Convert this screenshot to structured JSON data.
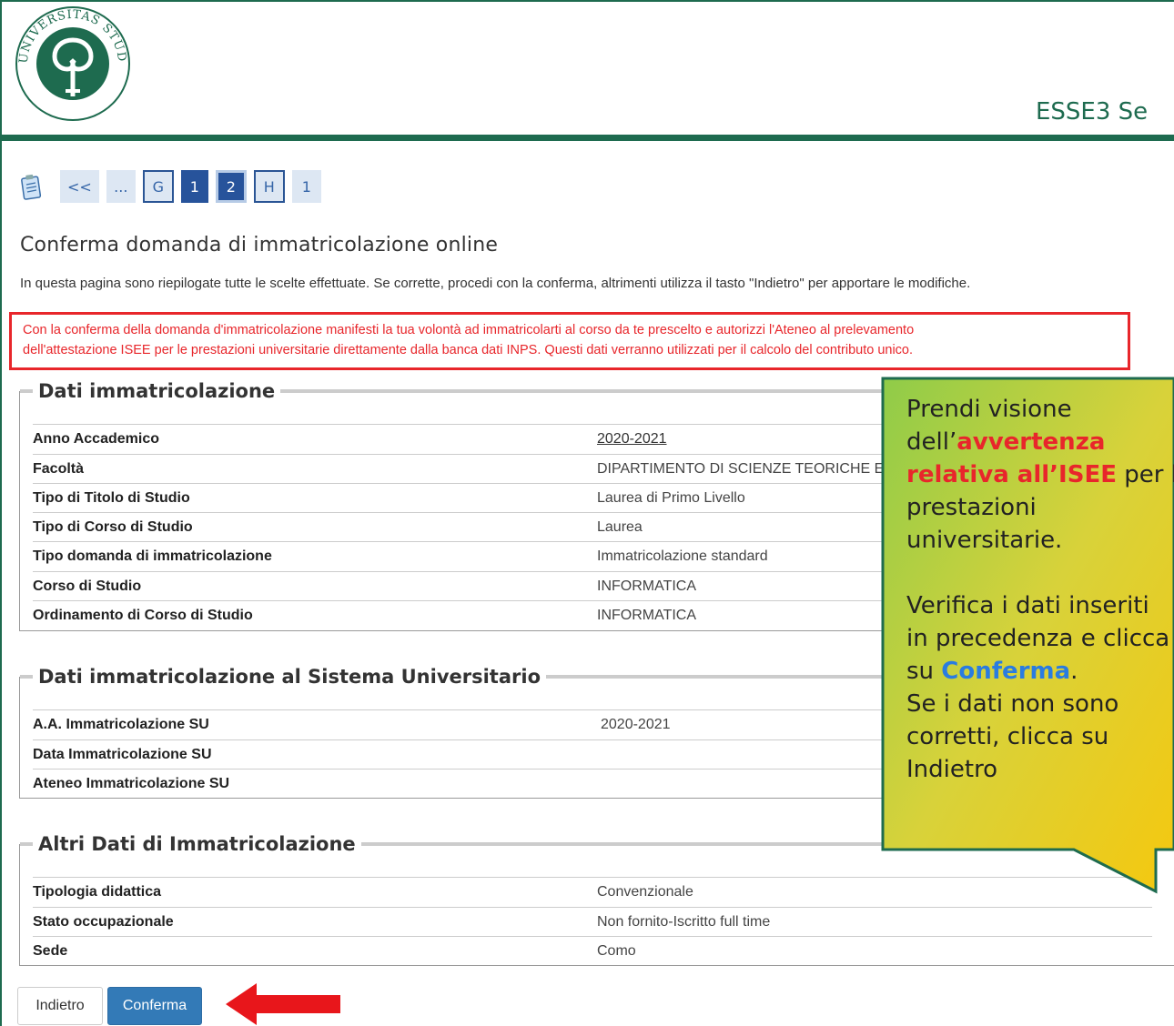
{
  "header": {
    "system_name": "ESSE3 Se",
    "logo_icon": "university-seal-icon",
    "logo_text": "UNIVERSITAS STUDIORUM INSUBRIAE"
  },
  "wizard": {
    "steps": [
      "<<",
      "...",
      "G",
      "1",
      "2",
      "H",
      "1"
    ]
  },
  "page": {
    "title": "Conferma domanda di immatricolazione online",
    "intro": "In questa pagina sono riepilogate tutte le scelte effettuate. Se corrette, procedi con la conferma, altrimenti utilizza il tasto \"Indietro\" per apportare le modifiche.",
    "warning_line1": "Con la conferma della domanda d'immatricolazione manifesti la tua volontà ad immatricolarti al corso da te prescelto e autorizzi l'Ateneo al prelevamento",
    "warning_line2": "dell'attestazione ISEE per le prestazioni universitarie direttamente dalla banca dati INPS. Questi dati verranno utilizzati per il calcolo del contributo unico."
  },
  "sections": [
    {
      "title": "Dati immatricolazione",
      "rows": [
        {
          "label": "Anno Accademico",
          "value": "2020-2021"
        },
        {
          "label": "Facoltà",
          "value": "DIPARTIMENTO DI SCIENZE TEORICHE E"
        },
        {
          "label": "Tipo di Titolo di Studio",
          "value": "Laurea di Primo Livello"
        },
        {
          "label": "Tipo di Corso di Studio",
          "value": "Laurea"
        },
        {
          "label": "Tipo domanda di immatricolazione",
          "value": "Immatricolazione standard"
        },
        {
          "label": "Corso di Studio",
          "value": "INFORMATICA"
        },
        {
          "label": "Ordinamento di Corso di Studio",
          "value": "INFORMATICA"
        }
      ]
    },
    {
      "title": "Dati immatricolazione al Sistema Universitario",
      "rows": [
        {
          "label": "A.A. Immatricolazione SU",
          "value": "2020-2021"
        },
        {
          "label": "Data Immatricolazione SU",
          "value": ""
        },
        {
          "label": "Ateneo Immatricolazione SU",
          "value": ""
        }
      ]
    },
    {
      "title": "Altri Dati di Immatricolazione",
      "rows": [
        {
          "label": "Tipologia didattica",
          "value": "Convenzionale"
        },
        {
          "label": "Stato occupazionale",
          "value": "Non fornito-Iscritto full time"
        },
        {
          "label": "Sede",
          "value": "Como"
        }
      ]
    }
  ],
  "buttons": {
    "back": "Indietro",
    "confirm": "Conferma"
  },
  "callout": {
    "l1": "Prendi visione",
    "l2a": "dell’",
    "l2b": "avvertenza",
    "l3a": "relativa all’ISEE",
    "l3b": " per le",
    "l4": "prestazioni",
    "l5": "universitarie.",
    "l6": "Verifica i dati inseriti",
    "l7": "in precedenza e clicca",
    "l8a": "su ",
    "l8b": "Conferma",
    "l8c": ".",
    "l9": "Se i dati non sono",
    "l10": "corretti, clicca su",
    "l11": "Indietro"
  },
  "colors": {
    "brand_green": "#1e6b4f",
    "warning_red": "#e8262b",
    "primary_blue": "#337ab7"
  }
}
